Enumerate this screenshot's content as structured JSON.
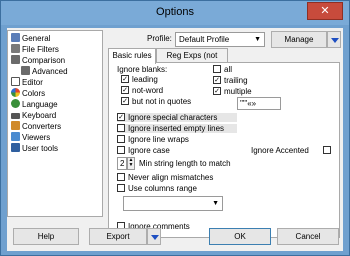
{
  "window": {
    "title": "Options",
    "close_glyph": "✕"
  },
  "tree": {
    "items": [
      {
        "label": "General",
        "icon": "general-icon",
        "color": "#5a7db8"
      },
      {
        "label": "File Filters",
        "icon": "file-filters-icon",
        "color": "#7a7a7a"
      },
      {
        "label": "Comparison",
        "icon": "comparison-icon",
        "color": "#6b6b6b"
      },
      {
        "label": "Advanced",
        "icon": "advanced-icon",
        "color": "#6b6b6b"
      },
      {
        "label": "Editor",
        "icon": "editor-icon",
        "color": "#ffffff"
      },
      {
        "label": "Colors",
        "icon": "colors-icon",
        "color": "#e0442a"
      },
      {
        "label": "Language",
        "icon": "language-icon",
        "color": "#3a8f3a"
      },
      {
        "label": "Keyboard",
        "icon": "keyboard-icon",
        "color": "#555555"
      },
      {
        "label": "Converters",
        "icon": "converters-icon",
        "color": "#d08a2a"
      },
      {
        "label": "Viewers",
        "icon": "viewers-icon",
        "color": "#4a8bd0"
      },
      {
        "label": "User tools",
        "icon": "user-tools-icon",
        "color": "#2f5f9f"
      }
    ]
  },
  "profile": {
    "label": "Profile:",
    "value": "Default Profile",
    "manage": "Manage"
  },
  "tabs": {
    "basic": "Basic rules",
    "regexp": "Reg Exps (not used)"
  },
  "rules": {
    "ignore_blanks": "Ignore blanks:",
    "leading": "leading",
    "not_word": "not-word",
    "but_not_quotes": "but not in quotes",
    "quote_chars": "'\"\"«»",
    "all": "all",
    "trailing": "trailing",
    "multiple": "multiple",
    "special_chars": "Ignore special characters",
    "empty_lines": "Ignore inserted empty lines",
    "line_wraps": "Ignore line wraps",
    "ignore_case": "Ignore case",
    "ignore_accented": "Ignore Accented",
    "min_length_value": "2",
    "min_length_label": "Min string length to match",
    "never_align": "Never align mismatches",
    "columns_range": "Use columns range",
    "columns_value": "",
    "ignore_comments": "Ignore comments",
    "check_mark": "✓"
  },
  "buttons": {
    "help": "Help",
    "export": "Export",
    "ok": "OK",
    "cancel": "Cancel"
  }
}
